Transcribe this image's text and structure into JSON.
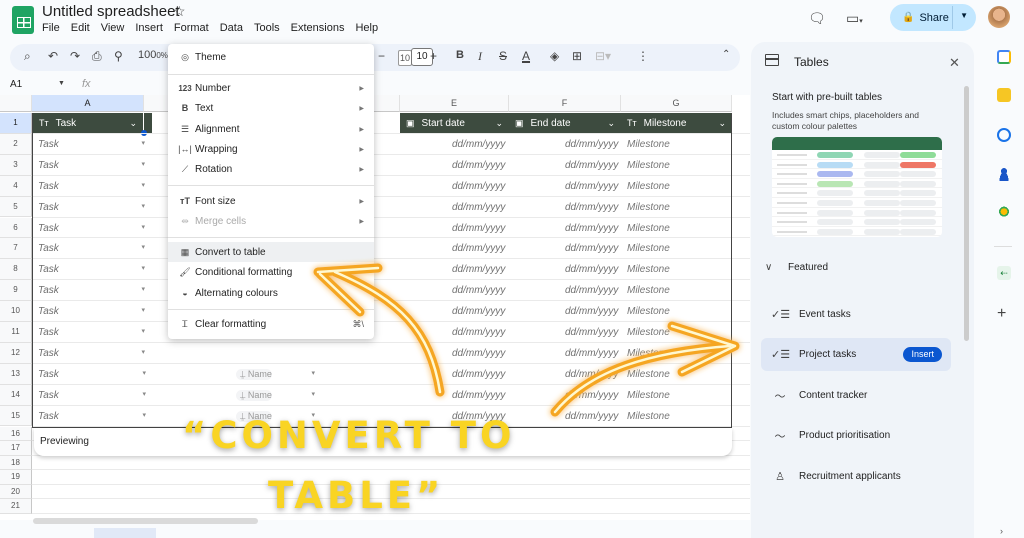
{
  "app": {
    "title": "Untitled spreadsheet",
    "menu": [
      "File",
      "Edit",
      "View",
      "Insert",
      "Format",
      "Data",
      "Tools",
      "Extensions",
      "Help"
    ],
    "share_label": "Share"
  },
  "toolbar": {
    "zoom": "100",
    "zoom_suffix": "0%",
    "font_size": "10",
    "font_size_behind": "10"
  },
  "namebox": {
    "cell": "A1",
    "fx": "fx"
  },
  "grid": {
    "columns": [
      "A",
      "E",
      "F",
      "G"
    ],
    "rows": [
      "1",
      "2",
      "3",
      "4",
      "5",
      "6",
      "7",
      "8",
      "9",
      "10",
      "11",
      "12",
      "13",
      "14",
      "15",
      "16",
      "17",
      "18",
      "19",
      "20",
      "21"
    ],
    "table_headers": {
      "task": "Task",
      "start": "Start date",
      "end": "End date",
      "milestone": "Milestone"
    },
    "task_placeholder": "Task",
    "date_placeholder": "dd/mm/yyyy",
    "milestone_placeholder": "Milestone",
    "name_placeholder": "Name",
    "preview_label": "Previewing"
  },
  "format_menu": {
    "items": [
      {
        "label": "Theme",
        "icon": "palette-icon"
      },
      {
        "label": "Number",
        "icon": "123-icon",
        "submenu": true
      },
      {
        "label": "Text",
        "icon": "bold-icon",
        "submenu": true
      },
      {
        "label": "Alignment",
        "icon": "align-icon",
        "submenu": true
      },
      {
        "label": "Wrapping",
        "icon": "wrap-icon",
        "submenu": true
      },
      {
        "label": "Rotation",
        "icon": "rotate-icon",
        "submenu": true
      },
      {
        "label": "Font size",
        "icon": "font-size-icon",
        "submenu": true
      },
      {
        "label": "Merge cells",
        "icon": "merge-icon",
        "submenu": true,
        "disabled": true
      },
      {
        "label": "Convert to table",
        "icon": "table-icon",
        "highlighted": true
      },
      {
        "label": "Conditional formatting",
        "icon": "paint-roller-icon"
      },
      {
        "label": "Alternating colours",
        "icon": "drop-icon"
      },
      {
        "label": "Clear formatting",
        "icon": "clear-format-icon",
        "shortcut": "⌘\\"
      }
    ]
  },
  "panel": {
    "title": "Tables",
    "prebuilt_title": "Start with pre-built tables",
    "prebuilt_desc": "Includes smart chips, placeholders and custom colour palettes",
    "featured_label": "Featured",
    "templates": [
      {
        "label": "Event tasks",
        "icon": "checklist-icon"
      },
      {
        "label": "Project tasks",
        "icon": "checklist-icon",
        "highlighted": true
      },
      {
        "label": "Content tracker",
        "icon": "trend-icon"
      },
      {
        "label": "Product prioritisation",
        "icon": "trend-icon"
      },
      {
        "label": "Recruitment applicants",
        "icon": "person-icon"
      }
    ],
    "insert_label": "Insert"
  },
  "annotation": {
    "line1": "“CONVERT TO",
    "line2": "TABLE”",
    "color": "#f9d423"
  }
}
